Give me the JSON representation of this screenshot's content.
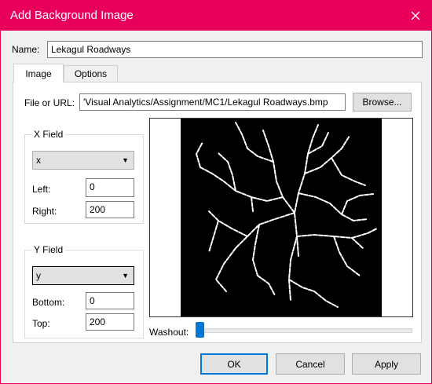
{
  "window": {
    "title": "Add Background Image"
  },
  "name_field": {
    "label": "Name:",
    "value": "Lekagul Roadways"
  },
  "tabs": [
    {
      "label": "Image",
      "active": true
    },
    {
      "label": "Options",
      "active": false
    }
  ],
  "file_field": {
    "label": "File or URL:",
    "value": "'Visual Analytics/Assignment/MC1/Lekagul Roadways.bmp",
    "browse_label": "Browse..."
  },
  "x_group": {
    "legend": "X Field",
    "field": "x",
    "left_label": "Left:",
    "left_value": "0",
    "right_label": "Right:",
    "right_value": "200"
  },
  "y_group": {
    "legend": "Y Field",
    "field": "y",
    "bottom_label": "Bottom:",
    "bottom_value": "0",
    "top_label": "Top:",
    "top_value": "200"
  },
  "washout": {
    "label": "Washout:",
    "level": 0
  },
  "buttons": {
    "ok": "OK",
    "cancel": "Cancel",
    "apply": "Apply"
  },
  "colors": {
    "titlebar": "#e8005a",
    "accent": "#0078d7",
    "map_bg": "#000000",
    "roads": "#ffffff"
  },
  "icons": {
    "close": "close-icon",
    "dropdown": "chevron-down-icon"
  }
}
